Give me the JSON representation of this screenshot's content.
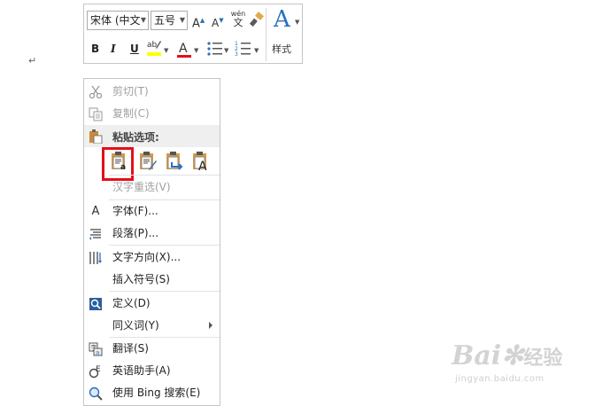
{
  "document": {
    "paragraph_mark": "↵"
  },
  "toolbar": {
    "font_name": "宋体 (中文",
    "font_size": "五号",
    "grow_font": "A",
    "shrink_font": "A",
    "phonetic_top": "wén",
    "phonetic_bottom": "文",
    "bold": "B",
    "italic": "I",
    "underline": "U",
    "font_color_glyph": "A",
    "styles_glyph": "A",
    "styles_label": "样式",
    "highlight_color": "#ffff00",
    "font_color": "#e3101a",
    "accent": "#2b6fbf"
  },
  "menu": {
    "cut": "剪切(T)",
    "copy": "复制(C)",
    "paste_options": "粘贴选项:",
    "hanzi_reselect": "汉字重选(V)",
    "font": "字体(F)...",
    "paragraph": "段落(P)...",
    "text_direction": "文字方向(X)...",
    "insert_symbol": "插入符号(S)",
    "define": "定义(D)",
    "synonyms": "同义词(Y)",
    "translate": "翻译(S)",
    "english_assistant": "英语助手(A)",
    "bing_search": "使用 Bing 搜索(E)",
    "font_icon_glyph": "A"
  },
  "highlight": {
    "color": "#e3101a"
  },
  "watermark": {
    "brand_latin": "Bai",
    "brand_cn": "经验",
    "sub": "jingyan.baidu.com"
  }
}
